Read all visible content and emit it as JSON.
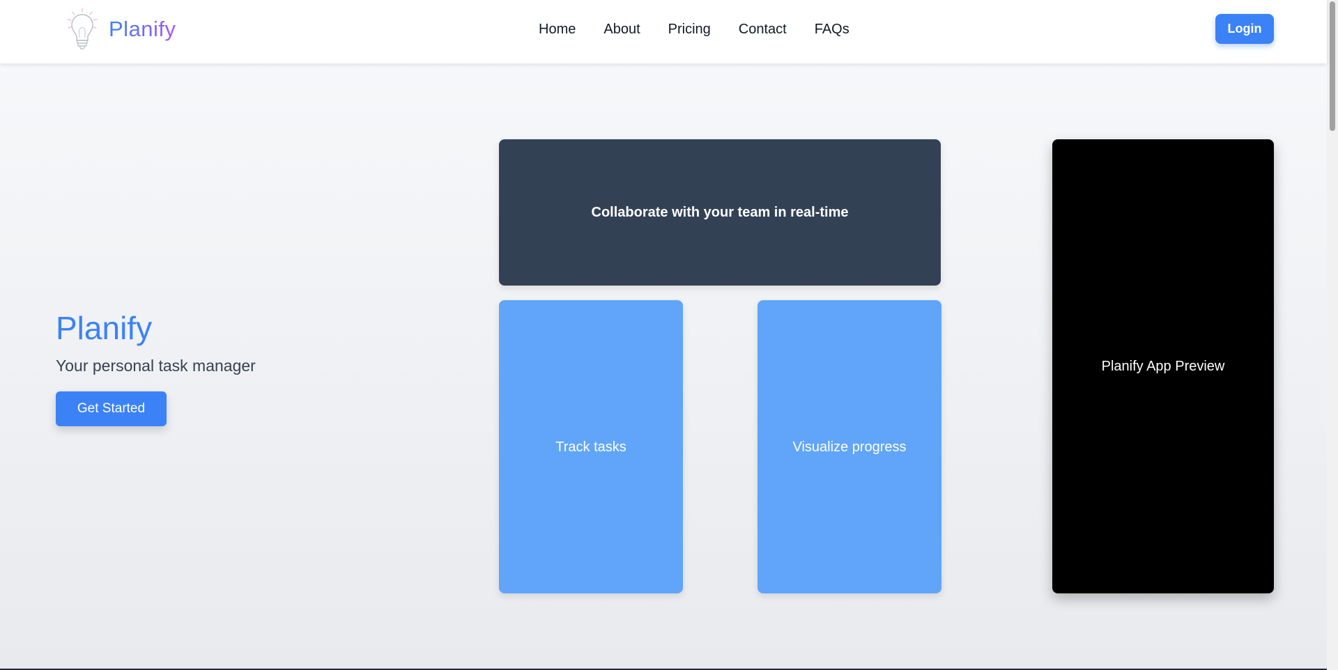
{
  "brand": {
    "name": "Planify",
    "icon": "lightbulb-icon",
    "gradient": [
      "#3b82f6",
      "#a855f7"
    ]
  },
  "nav": {
    "links": [
      "Home",
      "About",
      "Pricing",
      "Contact",
      "FAQs"
    ],
    "login_label": "Login"
  },
  "hero": {
    "title": "Planify",
    "subtitle": "Your personal task manager",
    "cta_label": "Get Started"
  },
  "cards": {
    "collaborate": "Collaborate with your team in real-time",
    "track": "Track tasks",
    "visualize": "Visualize progress",
    "preview": "Planify App Preview"
  },
  "colors": {
    "accent": "#3b82f6",
    "card_dark": "#334155",
    "card_light": "#60a5fa",
    "preview": "#000000"
  }
}
